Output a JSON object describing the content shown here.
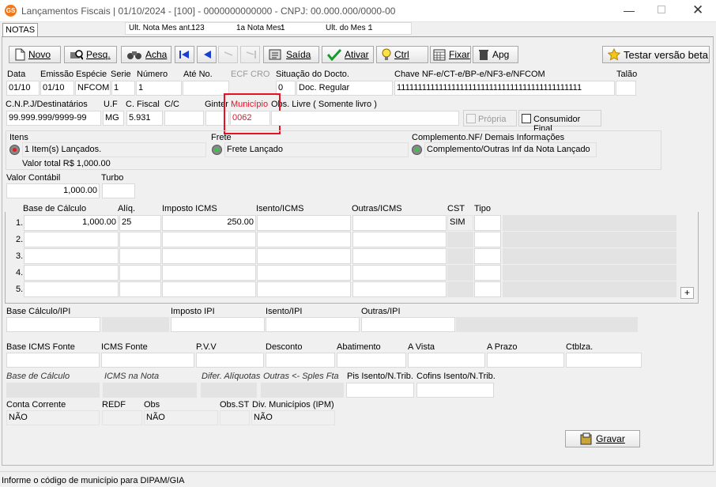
{
  "window": {
    "title": "Lançamentos Fiscais | 01/10/2024 - [100] - 0000000000000 - CNPJ: 00.000.000/0000-00",
    "app_icon": "gs-logo-icon"
  },
  "tab": {
    "label": "NOTAS"
  },
  "status_strip": {
    "ult_nota_ant_label": "Ult. Nota Mes ant.:",
    "ult_nota_ant_value": "123",
    "primeira_nota_label": "1a Nota Mes:",
    "primeira_nota_value": "1",
    "ult_mes_label": "Ult. do Mes :",
    "ult_mes_value": "1"
  },
  "toolbar": {
    "novo": "Novo",
    "pesq": "Pesq.",
    "acha": "Acha",
    "saida": "Saída",
    "ativar": "Ativar",
    "ctrl": "Ctrl",
    "fixar": "Fixar",
    "apg": "Apg",
    "testar": "Testar versão beta"
  },
  "doc": {
    "labels": {
      "data": "Data",
      "emissao": "Emissão",
      "especie": "Espécie",
      "serie": "Serie",
      "numero": "Número",
      "ate_no": "Até No.",
      "ecf": "ECF",
      "cro": "CRO",
      "situacao": "Situação do Docto.",
      "chave": "Chave NF-e/CT-e/BP-e/NF3-e/NFCOM",
      "talao": "Talão"
    },
    "values": {
      "data": "01/10",
      "emissao": "01/10",
      "especie": "NFCOM",
      "serie": "1",
      "numero": "1",
      "ate_no": "",
      "situacao_code": "0",
      "situacao_desc": "Doc. Regular",
      "chave": "11111111111111111111111111111111111111111111",
      "talao": ""
    }
  },
  "dest": {
    "labels": {
      "cnpj": "C.N.P.J/Destinatários",
      "uf": "U.F",
      "cfiscal": "C. Fiscal",
      "cc": "C/C",
      "ginter": "Ginter",
      "municipio": "Município",
      "obs_livre": "Obs. Livre ( Somente livro )",
      "propria": "Própria",
      "consumidor_final": "Consumidor Final"
    },
    "values": {
      "cnpj": "99.999.999/9999-99",
      "uf": "MG",
      "cfiscal": "5.931",
      "cc": "",
      "ginter": "",
      "municipio": "0062",
      "obs_livre": ""
    }
  },
  "itens": {
    "label": "Itens",
    "status": "1 Item(s) Lançados.",
    "total": "Valor total R$ 1,000.00"
  },
  "frete": {
    "label": "Frete",
    "status": "Frete Lançado"
  },
  "complemento": {
    "label": "Complemento.NF/ Demais Informações",
    "status": "Complemento/Outras Inf da Nota Lançado"
  },
  "valor_contabil": {
    "label": "Valor Contábil",
    "value": "1,000.00",
    "turbo_label": "Turbo",
    "turbo_value": ""
  },
  "icms_table": {
    "headers": [
      "Base de Cálculo",
      "Alíq.",
      "Imposto ICMS",
      "Isento/ICMS",
      "Outras/ICMS",
      "CST",
      "Tipo"
    ],
    "rows": [
      {
        "n": "1.",
        "base": "1,000.00",
        "aliq": "25",
        "imposto": "250.00",
        "isento": "",
        "outras": "",
        "cst": "SIM",
        "tipo": ""
      },
      {
        "n": "2.",
        "base": "",
        "aliq": "",
        "imposto": "",
        "isento": "",
        "outras": "",
        "cst": "",
        "tipo": ""
      },
      {
        "n": "3.",
        "base": "",
        "aliq": "",
        "imposto": "",
        "isento": "",
        "outras": "",
        "cst": "",
        "tipo": ""
      },
      {
        "n": "4.",
        "base": "",
        "aliq": "",
        "imposto": "",
        "isento": "",
        "outras": "",
        "cst": "",
        "tipo": ""
      },
      {
        "n": "5.",
        "base": "",
        "aliq": "",
        "imposto": "",
        "isento": "",
        "outras": "",
        "cst": "",
        "tipo": ""
      }
    ],
    "add_label": "+"
  },
  "ipi": {
    "base_label": "Base Cálculo/IPI",
    "imposto_label": "Imposto IPI",
    "isento_label": "Isento/IPI",
    "outras_label": "Outras/IPI"
  },
  "fonte": {
    "base_label": "Base ICMS Fonte",
    "icms_label": "ICMS Fonte",
    "pvv_label": "P.V.V",
    "desconto_label": "Desconto",
    "abatimento_label": "Abatimento",
    "avista_label": "A Vista",
    "aprazo_label": "A Prazo",
    "ctblza_label": "Ctblza."
  },
  "extra": {
    "base_calc_label": "Base de Cálculo",
    "icms_nota_label": "ICMS na Nota",
    "difer_label": "Difer. Alíquotas",
    "outras_label": "Outras <- Sples Fta",
    "pis_label": "Pis Isento/N.Trib.",
    "cofins_label": "Cofins Isento/N.Trib."
  },
  "bottom": {
    "conta_corrente_label": "Conta Corrente",
    "conta_corrente_value": "NÃO",
    "redf_label": "REDF",
    "obs_label": "Obs",
    "obs_value": "NÃO",
    "obsst_label": "Obs.ST",
    "div_municipios_label": "Div. Municípios (IPM)",
    "div_municipios_value": "NÃO"
  },
  "gravar": "Gravar",
  "statusbar": "Informe o código de município para DIPAM/GIA",
  "colors": {
    "highlight": "#e81123",
    "radio_green": "#2ecc40",
    "radio_red": "#e02020"
  }
}
